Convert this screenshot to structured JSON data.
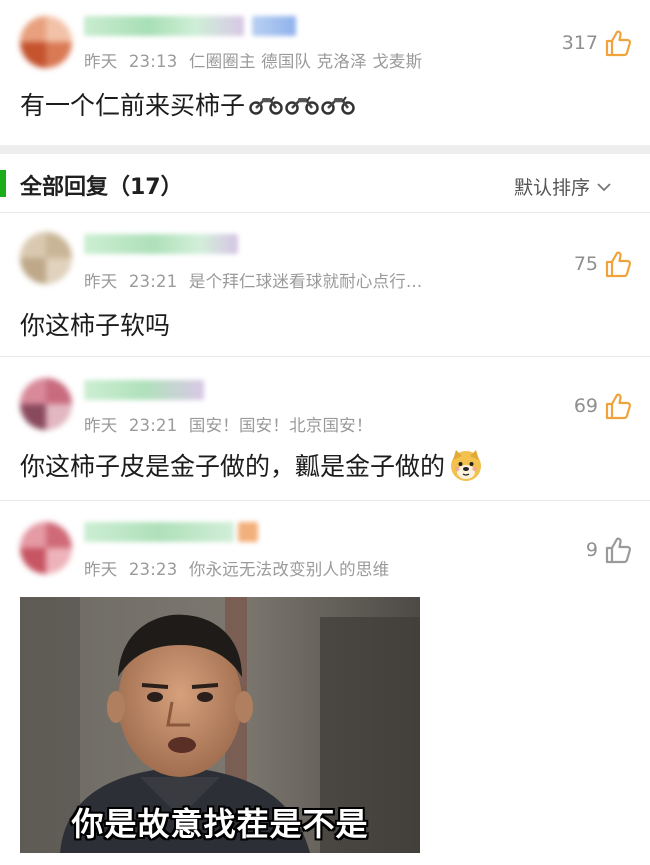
{
  "post": {
    "meta": {
      "date": "昨天",
      "time": "23:13",
      "tags": "仁圈圈主 德国队 克洛泽 戈麦斯"
    },
    "likes": "317",
    "text": "有一个仁前来买柿子",
    "emoji": "motorcycle-emoji"
  },
  "replies_header": {
    "title": "全部回复（17）",
    "sort_label": "默认排序"
  },
  "comments": [
    {
      "date": "昨天",
      "time": "23:21",
      "tagline": "是个拜仁球迷看球就耐心点行...",
      "likes": "75",
      "text": "你这柿子软吗"
    },
    {
      "date": "昨天",
      "time": "23:21",
      "tagline": "国安！国安！北京国安！",
      "likes": "69",
      "text": "你这柿子皮是金子做的，瓤是金子做的",
      "emoji": "doge-emoji"
    },
    {
      "date": "昨天",
      "time": "23:23",
      "tagline": "你永远无法改变别人的思维",
      "likes": "9",
      "image_caption": "你是故意找茬是不是"
    }
  ],
  "colors": {
    "accent_green": "#1aad19",
    "like_orange": "#f0a33c",
    "like_gray": "#9a9a9a",
    "meta_gray": "#9a9a9a"
  }
}
